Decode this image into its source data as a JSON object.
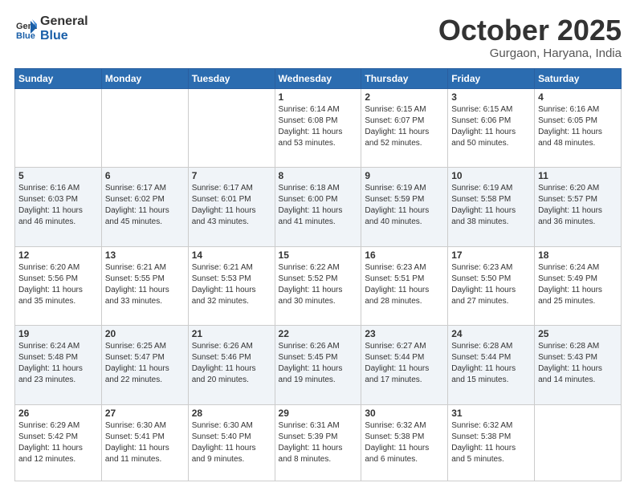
{
  "header": {
    "logo_line1": "General",
    "logo_line2": "Blue",
    "month": "October 2025",
    "location": "Gurgaon, Haryana, India"
  },
  "weekdays": [
    "Sunday",
    "Monday",
    "Tuesday",
    "Wednesday",
    "Thursday",
    "Friday",
    "Saturday"
  ],
  "rows": [
    [
      {
        "day": "",
        "content": ""
      },
      {
        "day": "",
        "content": ""
      },
      {
        "day": "",
        "content": ""
      },
      {
        "day": "1",
        "content": "Sunrise: 6:14 AM\nSunset: 6:08 PM\nDaylight: 11 hours\nand 53 minutes."
      },
      {
        "day": "2",
        "content": "Sunrise: 6:15 AM\nSunset: 6:07 PM\nDaylight: 11 hours\nand 52 minutes."
      },
      {
        "day": "3",
        "content": "Sunrise: 6:15 AM\nSunset: 6:06 PM\nDaylight: 11 hours\nand 50 minutes."
      },
      {
        "day": "4",
        "content": "Sunrise: 6:16 AM\nSunset: 6:05 PM\nDaylight: 11 hours\nand 48 minutes."
      }
    ],
    [
      {
        "day": "5",
        "content": "Sunrise: 6:16 AM\nSunset: 6:03 PM\nDaylight: 11 hours\nand 46 minutes."
      },
      {
        "day": "6",
        "content": "Sunrise: 6:17 AM\nSunset: 6:02 PM\nDaylight: 11 hours\nand 45 minutes."
      },
      {
        "day": "7",
        "content": "Sunrise: 6:17 AM\nSunset: 6:01 PM\nDaylight: 11 hours\nand 43 minutes."
      },
      {
        "day": "8",
        "content": "Sunrise: 6:18 AM\nSunset: 6:00 PM\nDaylight: 11 hours\nand 41 minutes."
      },
      {
        "day": "9",
        "content": "Sunrise: 6:19 AM\nSunset: 5:59 PM\nDaylight: 11 hours\nand 40 minutes."
      },
      {
        "day": "10",
        "content": "Sunrise: 6:19 AM\nSunset: 5:58 PM\nDaylight: 11 hours\nand 38 minutes."
      },
      {
        "day": "11",
        "content": "Sunrise: 6:20 AM\nSunset: 5:57 PM\nDaylight: 11 hours\nand 36 minutes."
      }
    ],
    [
      {
        "day": "12",
        "content": "Sunrise: 6:20 AM\nSunset: 5:56 PM\nDaylight: 11 hours\nand 35 minutes."
      },
      {
        "day": "13",
        "content": "Sunrise: 6:21 AM\nSunset: 5:55 PM\nDaylight: 11 hours\nand 33 minutes."
      },
      {
        "day": "14",
        "content": "Sunrise: 6:21 AM\nSunset: 5:53 PM\nDaylight: 11 hours\nand 32 minutes."
      },
      {
        "day": "15",
        "content": "Sunrise: 6:22 AM\nSunset: 5:52 PM\nDaylight: 11 hours\nand 30 minutes."
      },
      {
        "day": "16",
        "content": "Sunrise: 6:23 AM\nSunset: 5:51 PM\nDaylight: 11 hours\nand 28 minutes."
      },
      {
        "day": "17",
        "content": "Sunrise: 6:23 AM\nSunset: 5:50 PM\nDaylight: 11 hours\nand 27 minutes."
      },
      {
        "day": "18",
        "content": "Sunrise: 6:24 AM\nSunset: 5:49 PM\nDaylight: 11 hours\nand 25 minutes."
      }
    ],
    [
      {
        "day": "19",
        "content": "Sunrise: 6:24 AM\nSunset: 5:48 PM\nDaylight: 11 hours\nand 23 minutes."
      },
      {
        "day": "20",
        "content": "Sunrise: 6:25 AM\nSunset: 5:47 PM\nDaylight: 11 hours\nand 22 minutes."
      },
      {
        "day": "21",
        "content": "Sunrise: 6:26 AM\nSunset: 5:46 PM\nDaylight: 11 hours\nand 20 minutes."
      },
      {
        "day": "22",
        "content": "Sunrise: 6:26 AM\nSunset: 5:45 PM\nDaylight: 11 hours\nand 19 minutes."
      },
      {
        "day": "23",
        "content": "Sunrise: 6:27 AM\nSunset: 5:44 PM\nDaylight: 11 hours\nand 17 minutes."
      },
      {
        "day": "24",
        "content": "Sunrise: 6:28 AM\nSunset: 5:44 PM\nDaylight: 11 hours\nand 15 minutes."
      },
      {
        "day": "25",
        "content": "Sunrise: 6:28 AM\nSunset: 5:43 PM\nDaylight: 11 hours\nand 14 minutes."
      }
    ],
    [
      {
        "day": "26",
        "content": "Sunrise: 6:29 AM\nSunset: 5:42 PM\nDaylight: 11 hours\nand 12 minutes."
      },
      {
        "day": "27",
        "content": "Sunrise: 6:30 AM\nSunset: 5:41 PM\nDaylight: 11 hours\nand 11 minutes."
      },
      {
        "day": "28",
        "content": "Sunrise: 6:30 AM\nSunset: 5:40 PM\nDaylight: 11 hours\nand 9 minutes."
      },
      {
        "day": "29",
        "content": "Sunrise: 6:31 AM\nSunset: 5:39 PM\nDaylight: 11 hours\nand 8 minutes."
      },
      {
        "day": "30",
        "content": "Sunrise: 6:32 AM\nSunset: 5:38 PM\nDaylight: 11 hours\nand 6 minutes."
      },
      {
        "day": "31",
        "content": "Sunrise: 6:32 AM\nSunset: 5:38 PM\nDaylight: 11 hours\nand 5 minutes."
      },
      {
        "day": "",
        "content": ""
      }
    ]
  ]
}
